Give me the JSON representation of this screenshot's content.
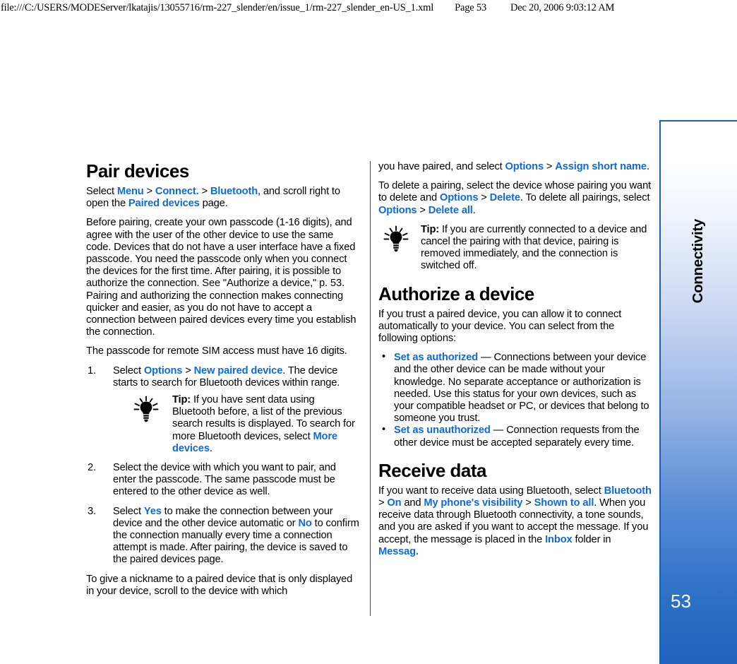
{
  "print_header": {
    "path": "file:///C:/USERS/MODEServer/lkatajis/13055716/rm-227_slender/en/issue_1/rm-227_slender_en-US_1.xml",
    "page_label": "Page 53",
    "date": "Dec 20, 2006 9:03:12 AM"
  },
  "sidebar": {
    "chapter_label": "Connectivity",
    "page_number": "53",
    "accent_color": "#1a5fb4"
  },
  "link_color": "#0f6ad8",
  "left_column": {
    "title": "Pair devices",
    "p_select_intro_1": "Select ",
    "link_menu": "Menu",
    "sep1": " > ",
    "link_connect": "Connect.",
    "sep2": " > ",
    "link_bluetooth": "Bluetooth",
    "p_select_intro_2": ", and scroll right to open the ",
    "link_paired_devices": "Paired devices",
    "p_select_intro_3": " page.",
    "p_before_pairing": "Before pairing, create your own passcode (1-16 digits), and agree with the user of the other device to use the same code. Devices that do not have a user interface have a fixed passcode. You need the passcode only when you connect the devices for the first time. After pairing, it is possible to authorize the connection. See \"Authorize a device,\" p. 53. Pairing and authorizing the connection makes connecting quicker and easier, as you do not have to accept a connection between paired devices every time you establish the connection.",
    "p_remote_sim": "The passcode for remote SIM access must have 16 digits.",
    "step1": {
      "num": "1.",
      "t1": "Select ",
      "link_options": "Options",
      "sep": " > ",
      "link_new_paired": "New paired device",
      "t2": ". The device starts to search for Bluetooth devices within range."
    },
    "tip1": {
      "icon": "lightbulb-icon",
      "label": "Tip:",
      "t1": " If you have sent data using Bluetooth before, a list of the previous search results is displayed. To search for more Bluetooth devices, select ",
      "link_more_devices": "More devices",
      "t2": "."
    },
    "step2": {
      "num": "2.",
      "t1": "Select the device with which you want to pair, and enter the passcode. The same passcode must be entered to the other device as well."
    },
    "step3": {
      "num": "3.",
      "t1": "Select ",
      "link_yes": "Yes",
      "t2": " to make the connection between your device and the other device automatic or ",
      "link_no": "No",
      "t3": " to confirm the connection manually every time a connection attempt is made. After pairing, the device is saved to the paired devices page."
    },
    "p_nickname": "To give a nickname to a paired device that is only displayed in your device, scroll to the device with which"
  },
  "right_column": {
    "p_continued_1": "you have paired, and select ",
    "link_options_1": "Options",
    "sep_1": " > ",
    "link_assign_short_name": "Assign short name",
    "p_continued_2": ".",
    "p_delete_1": "To delete a pairing, select the device whose pairing you want to delete and ",
    "link_options_2": "Options",
    "sep_2": " > ",
    "link_delete": "Delete",
    "p_delete_2": ". To delete all pairings, select ",
    "link_options_3": "Options",
    "sep_3": " > ",
    "link_delete_all": "Delete all",
    "p_delete_3": ".",
    "tip2": {
      "icon": "lightbulb-icon",
      "label": "Tip:",
      "t1": " If you are currently connected to a device and cancel the pairing with that device, pairing is removed immediately, and the connection is switched off."
    },
    "title_authorize": "Authorize a device",
    "p_authorize": "If you trust a paired device, you can allow it to connect automatically to your device. You can select from the following options:",
    "bullet1": {
      "dot": "•",
      "link": "Set as authorized",
      "text": " — Connections between your device and the other device can be made without your knowledge. No separate acceptance or authorization is needed. Use this status for your own devices, such as your compatible headset or PC, or devices that belong to someone you trust."
    },
    "bullet2": {
      "dot": "•",
      "link": "Set as unauthorized",
      "text": " — Connection requests from the other device must be accepted separately every time."
    },
    "title_receive": "Receive data",
    "p_receive_1": "If you want to receive data using Bluetooth, select ",
    "link_bluetooth": "Bluetooth",
    "sep_r1": " > ",
    "link_on": "On",
    "p_receive_2": " and ",
    "link_visibility": "My phone's visibility",
    "sep_r2": " > ",
    "link_shown_to_all": "Shown to all",
    "p_receive_3": ". When you receive data through Bluetooth connectivity, a tone sounds, and you are asked if you want to accept the message. If you accept, the message is placed in the ",
    "link_inbox": "Inbox",
    "p_receive_4": " folder in ",
    "link_messag": "Messag.",
    "p_receive_5": ""
  }
}
